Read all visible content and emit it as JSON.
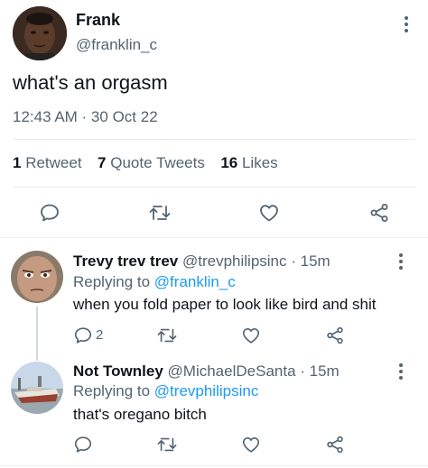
{
  "tweet": {
    "author_name": "Frank",
    "author_handle": "@franklin_c",
    "text": "what's an orgasm",
    "timestamp": "12:43 AM · 30 Oct 22",
    "stats": {
      "retweets_count": "1",
      "retweets_label": "Retweet",
      "quotes_count": "7",
      "quotes_label": "Quote Tweets",
      "likes_count": "16",
      "likes_label": "Likes"
    },
    "actions": [
      "reply-icon",
      "retweet-icon",
      "like-icon",
      "share-icon"
    ]
  },
  "replies": [
    {
      "author_name": "Trevy trev trev",
      "author_handle": "@trevphilipsinc",
      "time": "15m",
      "replying_to_label": "Replying to",
      "replying_to_handle": "@franklin_c",
      "text": "when you fold paper to look like bird and shit",
      "reply_count": "2"
    },
    {
      "author_name": "Not Townley",
      "author_handle": "@MichaelDeSanta",
      "time": "15m",
      "replying_to_label": "Replying to",
      "replying_to_handle": "@trevphilipsinc",
      "text": "that's oregano bitch",
      "reply_count": ""
    }
  ],
  "colors": {
    "accent": "#1d9bf0",
    "muted_text": "#536471",
    "primary_text": "#0f1419",
    "divider": "#e7e9ea"
  }
}
